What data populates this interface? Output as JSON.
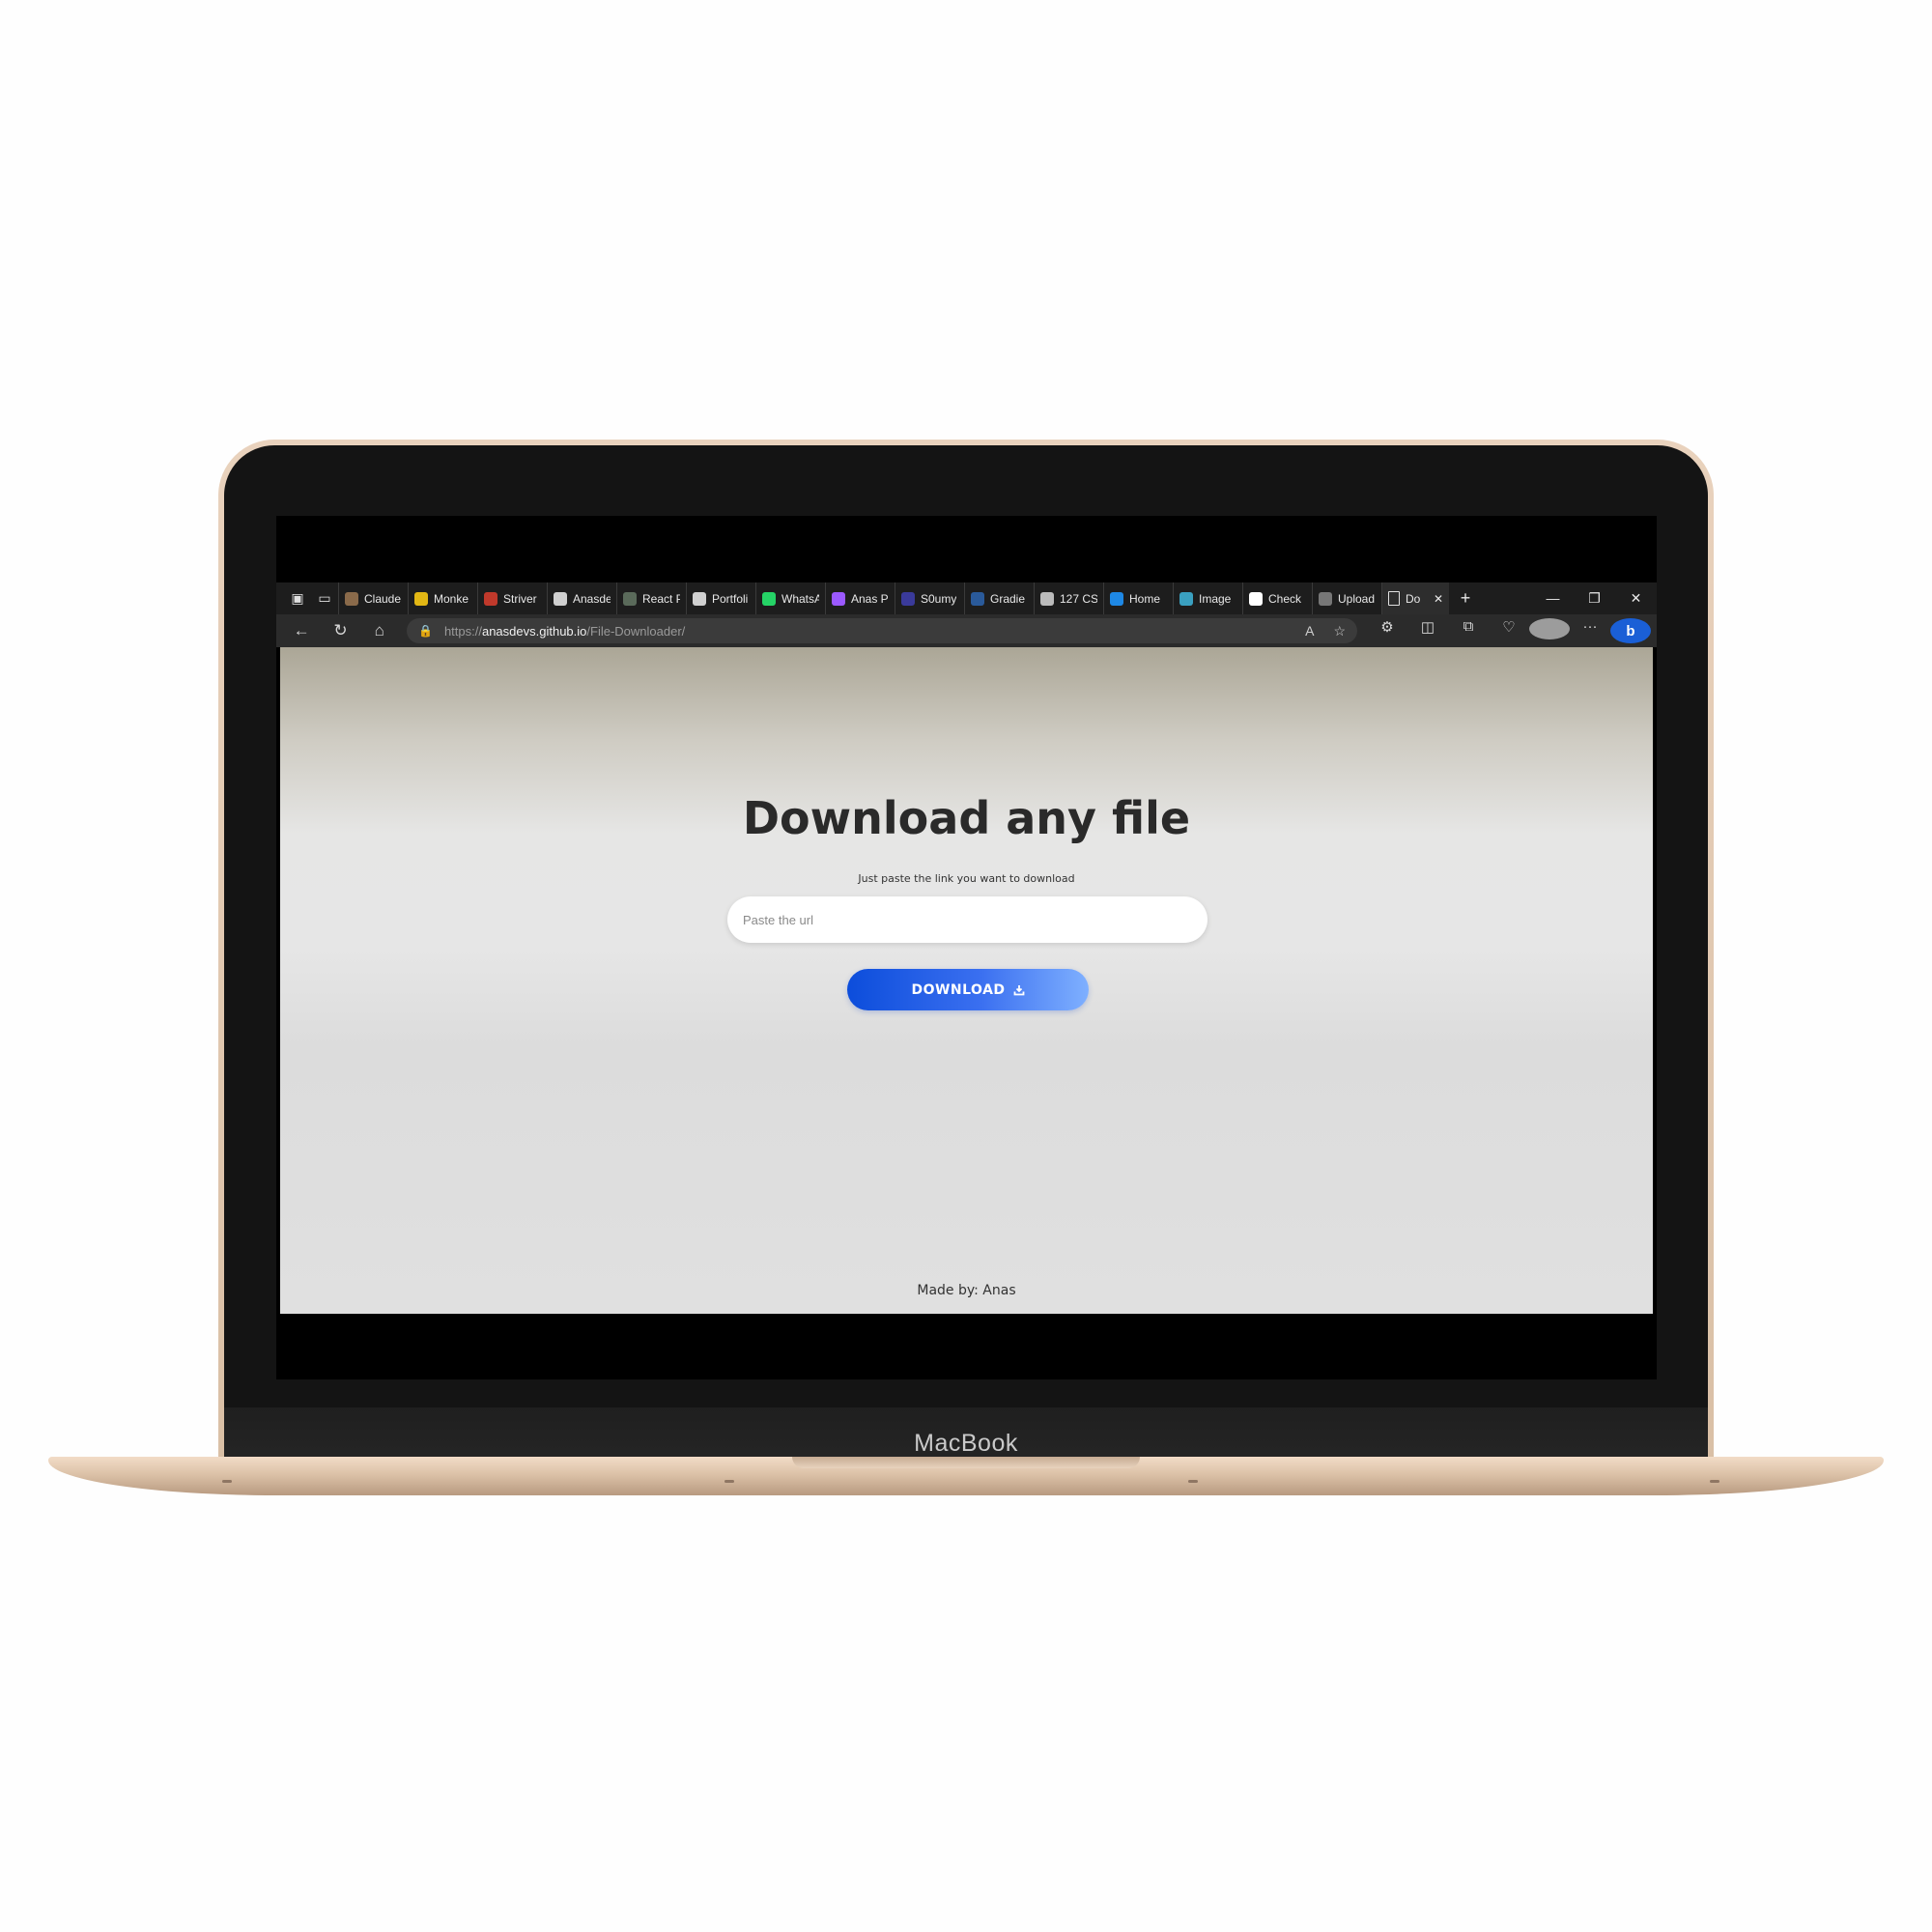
{
  "device": {
    "brand": "MacBook"
  },
  "browser": {
    "tabs": [
      {
        "label": "Claude",
        "icon": "claude-icon",
        "color": "#8a6a4a"
      },
      {
        "label": "Monke",
        "icon": "monkeytype-icon",
        "color": "#e2b714"
      },
      {
        "label": "Striver",
        "icon": "striver-icon",
        "color": "#c0392b"
      },
      {
        "label": "Anasde",
        "icon": "github-icon",
        "color": "#d0d0d0"
      },
      {
        "label": "React P",
        "icon": "react-icon",
        "color": "#5a6a5a"
      },
      {
        "label": "Portfoli",
        "icon": "github-icon",
        "color": "#d0d0d0"
      },
      {
        "label": "WhatsA",
        "icon": "whatsapp-icon",
        "color": "#25d366"
      },
      {
        "label": "Anas Pi",
        "icon": "vite-icon",
        "color": "#9b59ff"
      },
      {
        "label": "S0umy",
        "icon": "s0umy-icon",
        "color": "#3a3a9a"
      },
      {
        "label": "Gradie",
        "icon": "gradient-icon",
        "color": "#2a5a9a"
      },
      {
        "label": "127 CS",
        "icon": "css-icon",
        "color": "#bbbbbb"
      },
      {
        "label": "Home",
        "icon": "home-c-icon",
        "color": "#1e88e5"
      },
      {
        "label": "Image",
        "icon": "image-icon",
        "color": "#3aa0c0"
      },
      {
        "label": "Check",
        "icon": "check-icon",
        "color": "#ffffff"
      },
      {
        "label": "Upload",
        "icon": "upload-icon",
        "color": "#777777"
      }
    ],
    "active_tab": {
      "label": "Do",
      "icon": "document-icon",
      "color": "#e0e0e0"
    },
    "address": {
      "scheme": "https://",
      "host": "anasdevs.github.io",
      "path": "/File-Downloader/"
    }
  },
  "page": {
    "title": "Download any file",
    "subtitle": "Just paste the link you want to download",
    "input_placeholder": "Paste the url",
    "button_label": "DOWNLOAD",
    "footer": "Made by: Anas"
  }
}
